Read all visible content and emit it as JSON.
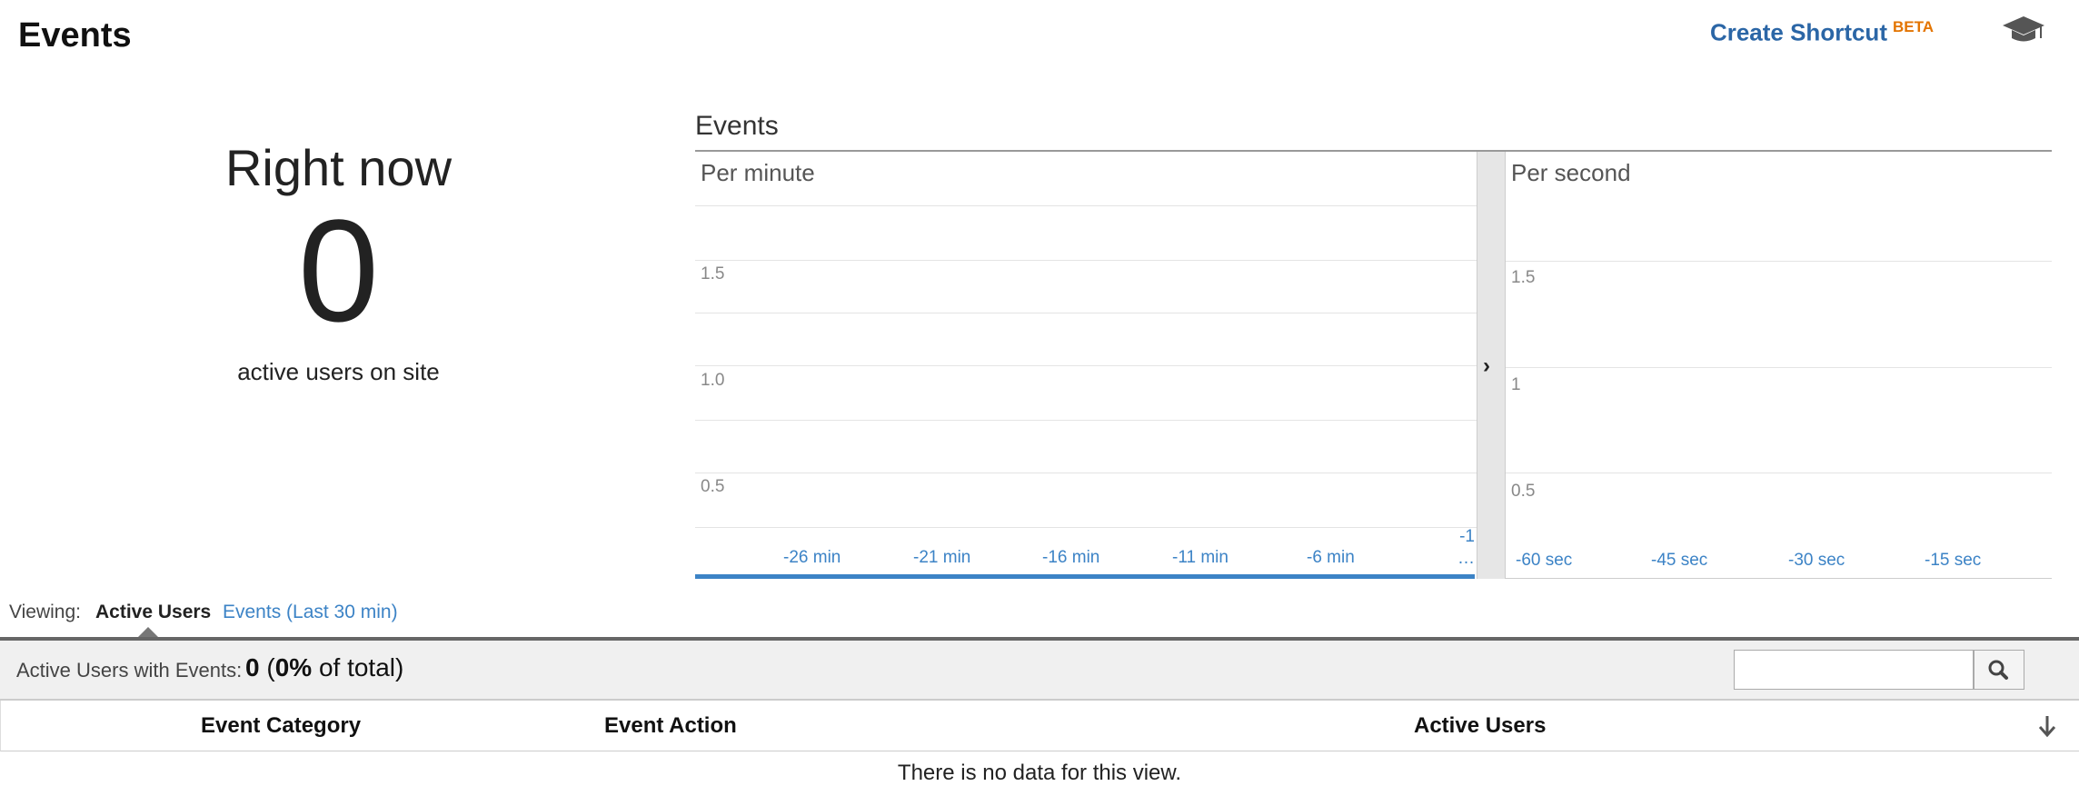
{
  "header": {
    "title": "Events",
    "shortcut_label": "Create Shortcut",
    "beta_label": "BETA",
    "icon": "graduation-cap-icon"
  },
  "right_now": {
    "title": "Right now",
    "count": "0",
    "subtitle": "active users on site"
  },
  "chart_section": {
    "title": "Events"
  },
  "chart_data": [
    {
      "type": "bar",
      "title": "Per minute",
      "y_ticks": [
        "1.5",
        "1.0",
        "0.5"
      ],
      "x_ticks": [
        "-26 min",
        "-21 min",
        "-16 min",
        "-11 min",
        "-6 min",
        "-1 …"
      ],
      "ylim": [
        0,
        2
      ],
      "values": []
    },
    {
      "type": "bar",
      "title": "Per second",
      "y_ticks": [
        "1.5",
        "1",
        "0.5"
      ],
      "x_ticks": [
        "-60 sec",
        "-45 sec",
        "-30 sec",
        "-15 sec"
      ],
      "ylim": [
        0,
        2
      ],
      "values": []
    }
  ],
  "viewing": {
    "label": "Viewing:",
    "active_tab": "Active Users",
    "other_tab": "Events (Last 30 min)"
  },
  "summary": {
    "label": "Active Users with Events:",
    "value_count": "0",
    "value_pct": "0%",
    "value_suffix": "of total)",
    "value_prefix": "("
  },
  "table": {
    "columns": [
      "Event Category",
      "Event Action",
      "Active Users"
    ],
    "empty_message": "There is no data for this view."
  },
  "colors": {
    "accent": "#3c83c6",
    "link": "#2b66a6",
    "beta": "#e37400"
  }
}
